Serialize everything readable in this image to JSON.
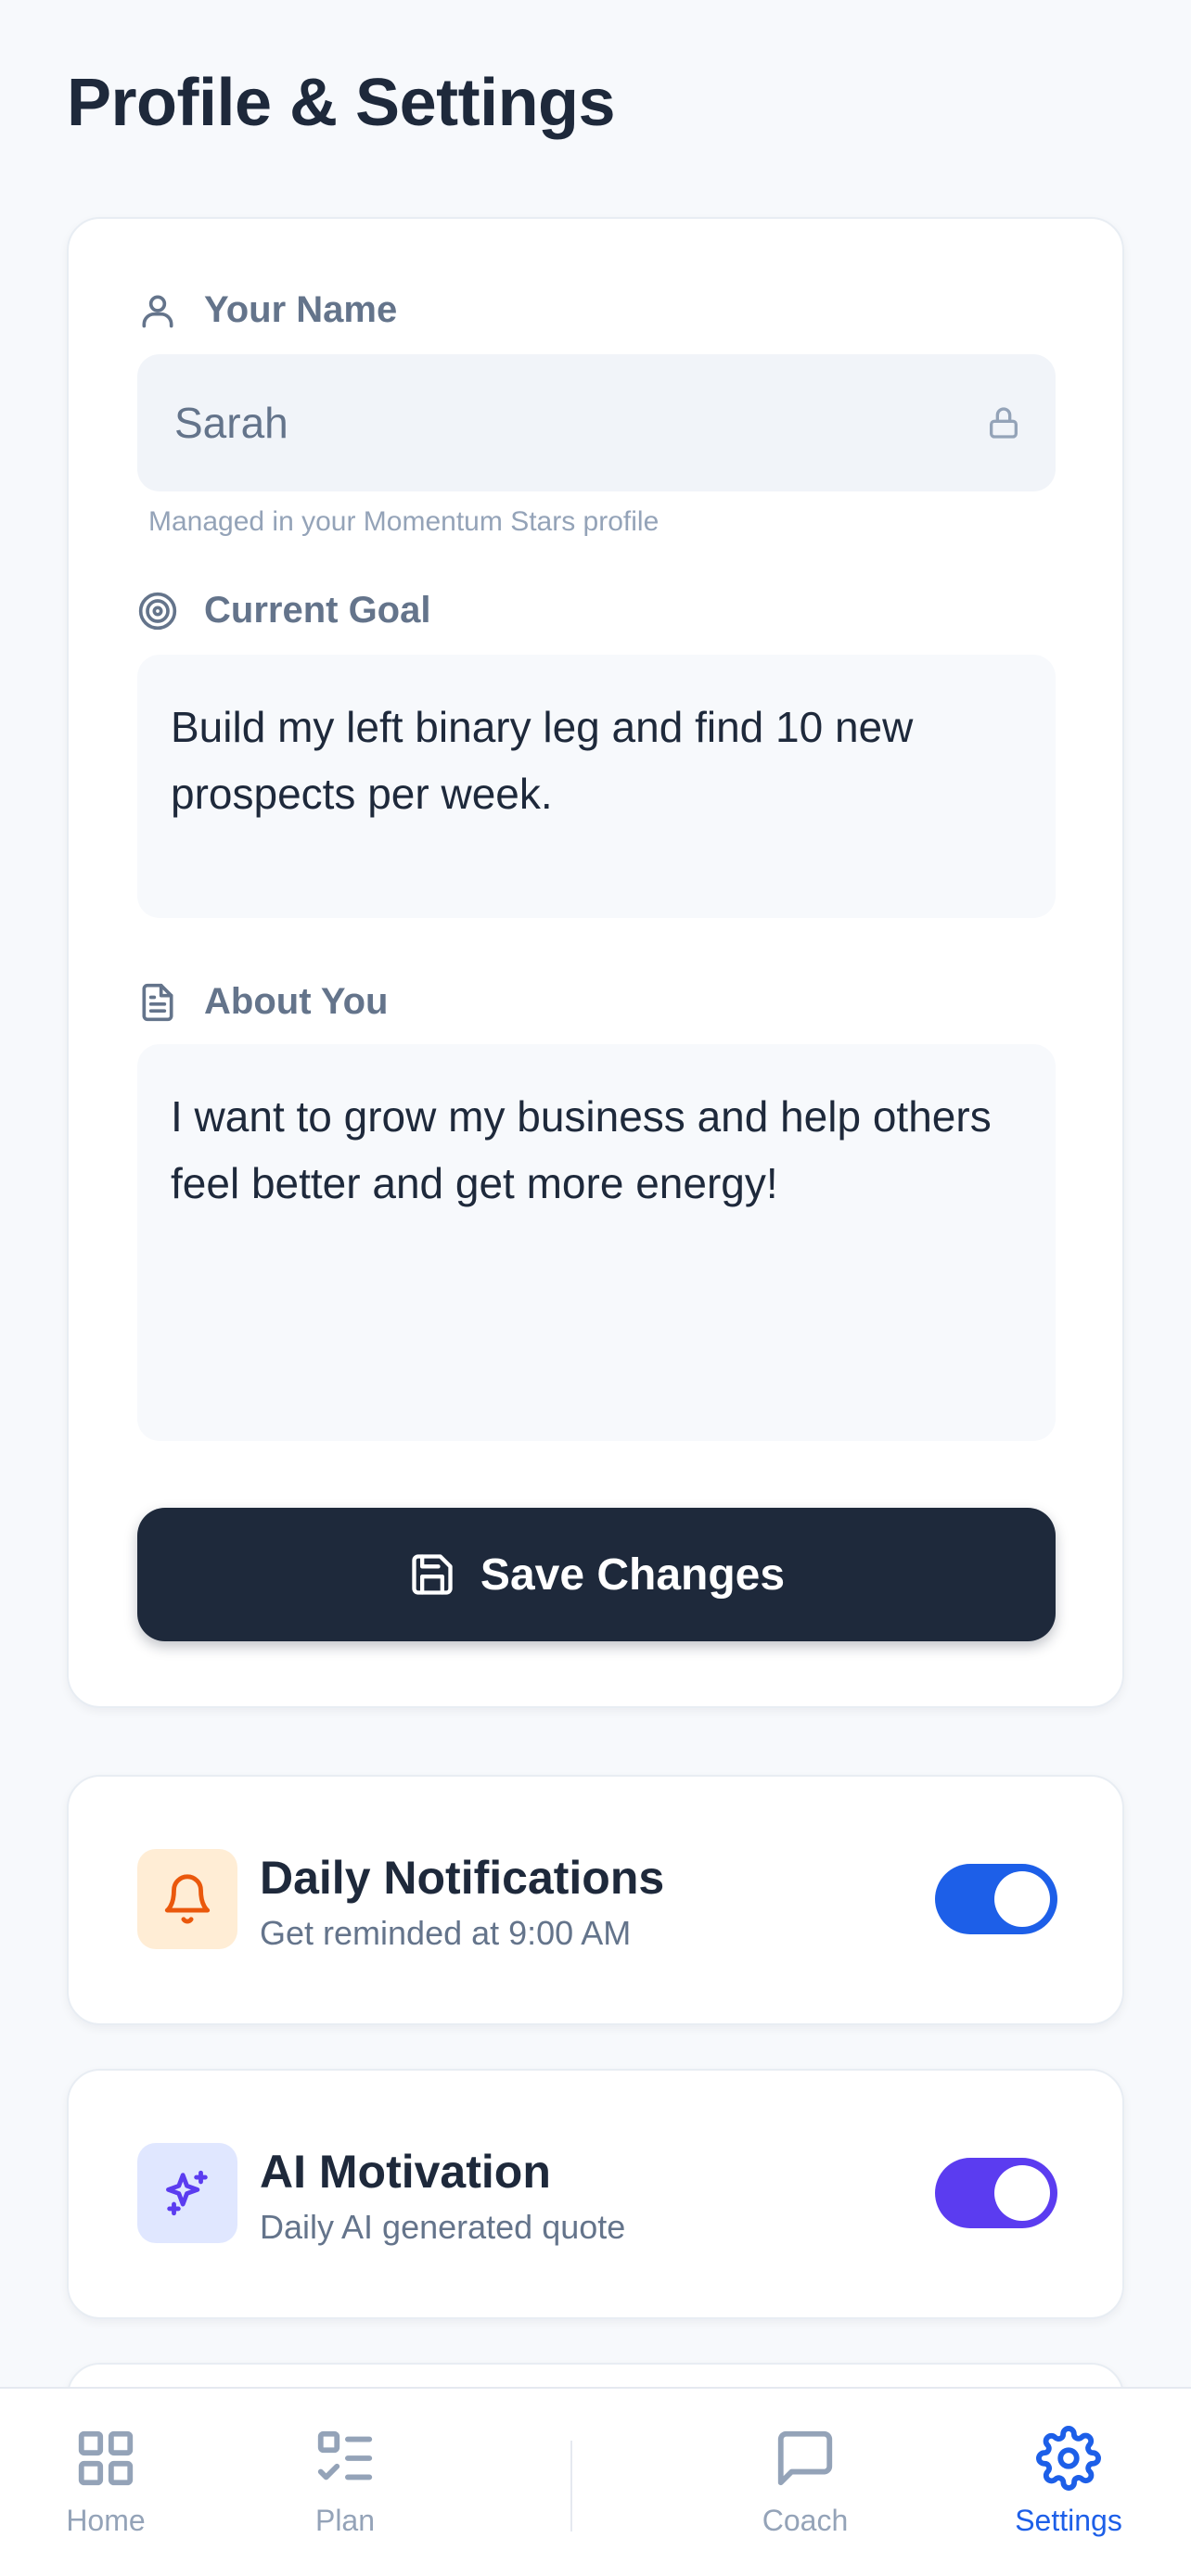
{
  "page": {
    "title": "Profile & Settings"
  },
  "profile": {
    "name_label": "Your Name",
    "name_value": "Sarah",
    "name_helper": "Managed in your Momentum Stars profile",
    "goal_label": "Current Goal",
    "goal_value": "Build my left binary leg and find 10 new prospects per week.",
    "about_label": "About You",
    "about_value": "I want to grow my business and help others feel better and get more energy!",
    "save_label": "Save Changes"
  },
  "settings": {
    "notifications": {
      "title": "Daily Notifications",
      "subtitle": "Get reminded at 9:00 AM",
      "enabled": true,
      "icon": "bell-icon",
      "toggle_color": "#1d5fe8"
    },
    "ai_motivation": {
      "title": "AI Motivation",
      "subtitle": "Daily AI generated quote",
      "enabled": true,
      "icon": "sparkles-icon",
      "toggle_color": "#5b3cf0"
    }
  },
  "nav": {
    "items": [
      {
        "label": "Home",
        "icon": "grid-icon",
        "active": false
      },
      {
        "label": "Plan",
        "icon": "checklist-icon",
        "active": false
      },
      {
        "label": "Coach",
        "icon": "chat-bubble-icon",
        "active": false
      },
      {
        "label": "Settings",
        "icon": "gear-icon",
        "active": true
      }
    ]
  },
  "colors": {
    "primary_dark": "#1e293b",
    "active_nav": "#1d5fe8",
    "notification_icon_bg": "#ffedd5",
    "notification_icon": "#ea580c",
    "ai_icon_bg": "#e0e7ff",
    "ai_icon": "#5b3cf0"
  }
}
